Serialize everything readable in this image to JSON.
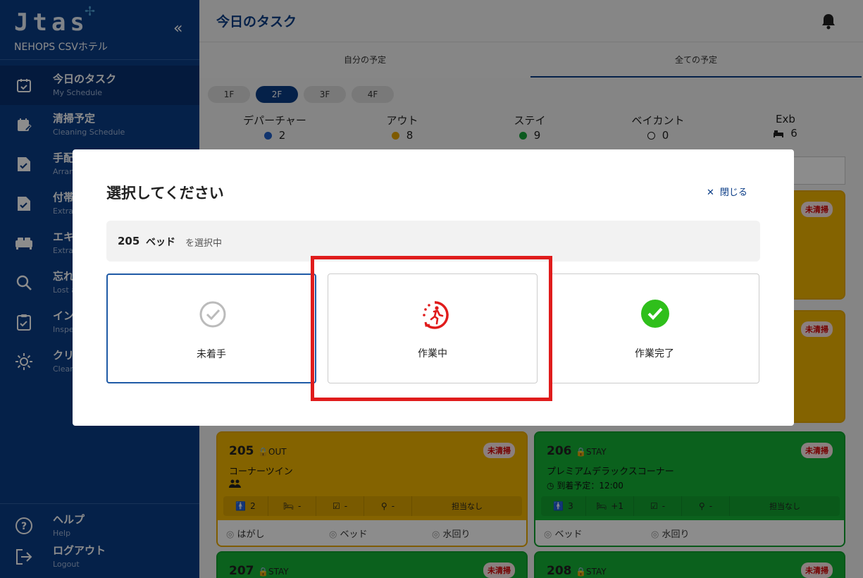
{
  "app": {
    "logo": "Jtas",
    "hotel": "NEHOPS CSVホテル",
    "collapse": "«"
  },
  "sidebar": {
    "items": [
      {
        "label": "今日のタスク",
        "sub": "My Schedule"
      },
      {
        "label": "清掃予定",
        "sub": "Cleaning Schedule"
      },
      {
        "label": "手配",
        "sub": "Arran"
      },
      {
        "label": "付帯",
        "sub": "Extra"
      },
      {
        "label": "エキ",
        "sub": "Extra"
      },
      {
        "label": "忘れ",
        "sub": "Lost a"
      },
      {
        "label": "イン",
        "sub": "Inspe"
      },
      {
        "label": "クリ",
        "sub": "Clean"
      }
    ],
    "bottom": [
      {
        "label": "ヘルプ",
        "sub": "Help"
      },
      {
        "label": "ログアウト",
        "sub": "Logout"
      }
    ]
  },
  "header": {
    "title": "今日のタスク"
  },
  "tabs": [
    {
      "label": "自分の予定"
    },
    {
      "label": "全ての予定"
    }
  ],
  "floors": [
    "1F",
    "2F",
    "3F",
    "4F"
  ],
  "summary": [
    {
      "label": "デパーチャー",
      "value": "2",
      "color": "#1f5fc9"
    },
    {
      "label": "アウト",
      "value": "8",
      "color": "#e5a400"
    },
    {
      "label": "ステイ",
      "value": "9",
      "color": "#14a43a"
    },
    {
      "label": "ベイカント",
      "value": "0",
      "color": "#ffffff"
    },
    {
      "label": "Exb",
      "value": "6",
      "color": "#222222"
    }
  ],
  "cards": [
    {
      "room": "205",
      "type": "OUT",
      "badge": "未清掃",
      "name": "コーナーツイン",
      "arrival": "",
      "strip": [
        "2",
        "-",
        "-",
        "-",
        "担当なし"
      ],
      "foot": [
        "はがし",
        "ベッド",
        "水回り"
      ]
    },
    {
      "room": "206",
      "type": "STAY",
      "badge": "未清掃",
      "name": "プレミアムデラックスコーナー",
      "arrival": "到着予定：12:00",
      "strip": [
        "3",
        "+1",
        "-",
        "-",
        "担当なし"
      ],
      "foot": [
        "ベッド",
        "水回り"
      ]
    },
    {
      "room": "207",
      "type": "STAY",
      "badge": "未清掃"
    },
    {
      "room": "208",
      "type": "STAY",
      "badge": "未清掃"
    }
  ],
  "partial_badges": [
    "未清掃",
    "未清掃"
  ],
  "modal": {
    "title": "選択してください",
    "close_label": "閉じる",
    "selection": {
      "room": "205",
      "kind": "ベッド",
      "suffix": "を選択中"
    },
    "options": [
      {
        "label": "未着手"
      },
      {
        "label": "作業中"
      },
      {
        "label": "作業完了"
      }
    ]
  }
}
